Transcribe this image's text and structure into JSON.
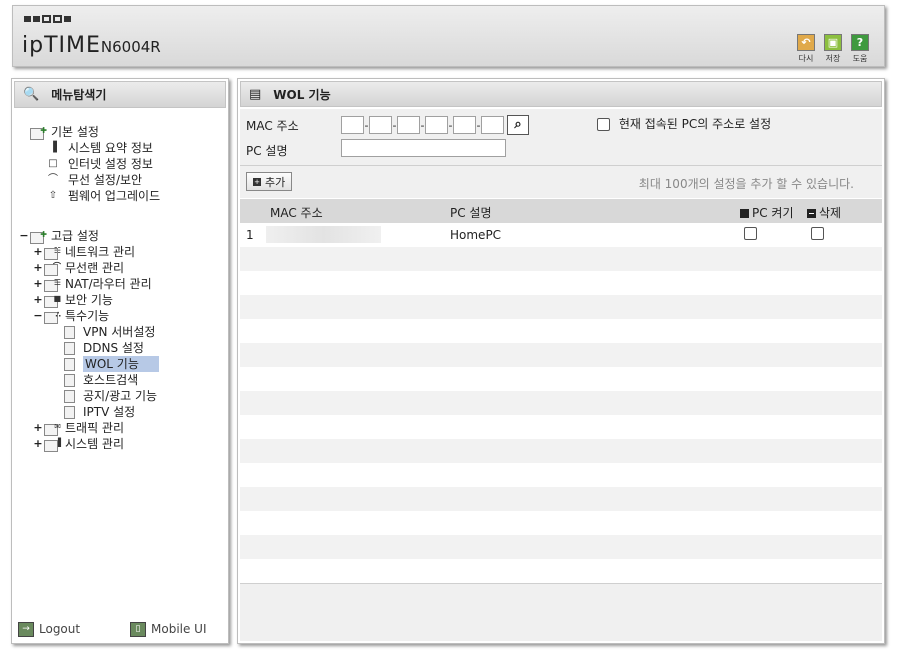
{
  "header": {
    "brand": "ipTIME",
    "model": "N6004R",
    "buttons": [
      {
        "label": "다시",
        "icon": "undo-icon",
        "color": "#e0a94a"
      },
      {
        "label": "저장",
        "icon": "save-icon",
        "color": "#8cbf3f"
      },
      {
        "label": "도움",
        "icon": "help-icon",
        "color": "#3f9a3f",
        "glyph": "?"
      }
    ]
  },
  "left": {
    "title": "메뉴탐색기",
    "tree": [
      {
        "label": "기본 설정",
        "expander": "",
        "level": 0,
        "kind": "folder"
      },
      {
        "label": "시스템 요약 정보",
        "level": 1,
        "kind": "item",
        "icon": "bar-chart-icon"
      },
      {
        "label": "인터넷 설정 정보",
        "level": 1,
        "kind": "item",
        "icon": "monitor-icon"
      },
      {
        "label": "무선 설정/보안",
        "level": 1,
        "kind": "item",
        "icon": "wifi-icon"
      },
      {
        "label": "펌웨어 업그레이드",
        "level": 1,
        "kind": "item",
        "icon": "upgrade-icon"
      },
      {
        "label": "고급 설정",
        "expander": "−",
        "level": 0,
        "kind": "folder"
      },
      {
        "label": "네트워크 관리",
        "expander": "+",
        "level": 1,
        "kind": "subfolder",
        "icon": "network-icon"
      },
      {
        "label": "무선랜 관리",
        "expander": "+",
        "level": 1,
        "kind": "subfolder",
        "icon": "wifi-icon"
      },
      {
        "label": "NAT/라우터 관리",
        "expander": "+",
        "level": 1,
        "kind": "subfolder",
        "icon": "router-icon"
      },
      {
        "label": "보안 기능",
        "expander": "+",
        "level": 1,
        "kind": "subfolder",
        "icon": "lock-icon"
      },
      {
        "label": "특수기능",
        "expander": "−",
        "level": 1,
        "kind": "subfolder",
        "icon": "special-icon"
      },
      {
        "label": "VPN 서버설정",
        "level": 2,
        "kind": "page"
      },
      {
        "label": "DDNS 설정",
        "level": 2,
        "kind": "page"
      },
      {
        "label": "WOL 기능",
        "level": 2,
        "kind": "page",
        "selected": true
      },
      {
        "label": "호스트검색",
        "level": 2,
        "kind": "page"
      },
      {
        "label": "공지/광고 기능",
        "level": 2,
        "kind": "page"
      },
      {
        "label": "IPTV 설정",
        "level": 2,
        "kind": "page"
      },
      {
        "label": "트래픽 관리",
        "expander": "+",
        "level": 1,
        "kind": "subfolder",
        "icon": "traffic-icon"
      },
      {
        "label": "시스템 관리",
        "expander": "+",
        "level": 1,
        "kind": "subfolder",
        "icon": "system-icon"
      }
    ],
    "footer": {
      "logout": "Logout",
      "mobile": "Mobile UI"
    }
  },
  "main": {
    "title": "WOL 기능",
    "form": {
      "mac_label": "MAC 주소",
      "mac_fields": [
        "",
        "",
        "",
        "",
        "",
        ""
      ],
      "current_pc_label": "현재 접속된 PC의 주소로 설정",
      "current_pc_checked": false,
      "pc_desc_label": "PC 설명",
      "pc_desc_value": ""
    },
    "add_button": "추가",
    "add_note": "최대 100개의 설정을 추가 할 수 있습니다.",
    "table": {
      "headers": [
        "MAC 주소",
        "PC 설명",
        "PC 켜기",
        "삭제"
      ],
      "rows": [
        {
          "index": "1",
          "mac": "",
          "desc": "HomePC",
          "wake": false,
          "del": false
        }
      ],
      "empty_rows": 14
    }
  }
}
